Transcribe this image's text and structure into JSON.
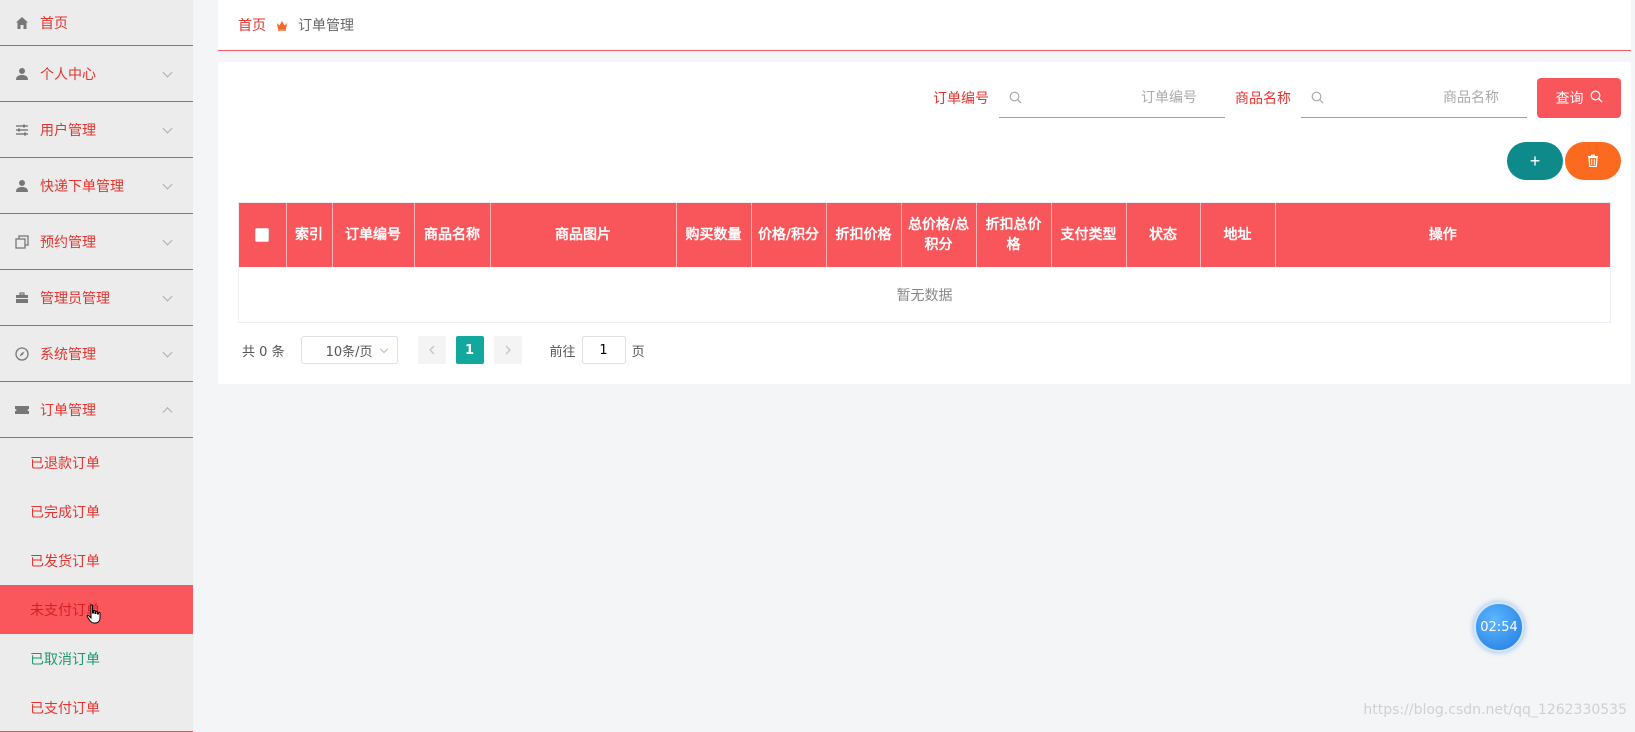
{
  "sidebar": {
    "items": [
      {
        "label": "首页",
        "icon": "home-icon"
      },
      {
        "label": "个人中心",
        "icon": "user-icon"
      },
      {
        "label": "用户管理",
        "icon": "sliders-icon"
      },
      {
        "label": "快递下单管理",
        "icon": "user-icon"
      },
      {
        "label": "预约管理",
        "icon": "copy-icon"
      },
      {
        "label": "管理员管理",
        "icon": "briefcase-icon"
      },
      {
        "label": "系统管理",
        "icon": "compass-icon"
      },
      {
        "label": "订单管理",
        "icon": "ticket-icon"
      }
    ],
    "submenu": [
      {
        "label": "已退款订单"
      },
      {
        "label": "已完成订单"
      },
      {
        "label": "已发货订单"
      },
      {
        "label": "未支付订单"
      },
      {
        "label": "已取消订单"
      },
      {
        "label": "已支付订单"
      }
    ]
  },
  "breadcrumb": {
    "home": "首页",
    "current": "订单管理"
  },
  "search": {
    "order_no_label": "订单编号",
    "order_no_placeholder": "订单编号",
    "product_label": "商品名称",
    "product_placeholder": "商品名称",
    "query_label": "查询"
  },
  "actions": {
    "add_symbol": "+"
  },
  "table": {
    "headers": [
      "索引",
      "订单编号",
      "商品名称",
      "商品图片",
      "购买数量",
      "价格/积分",
      "折扣价格",
      "总价格/总积分",
      "折扣总价格",
      "支付类型",
      "状态",
      "地址",
      "操作"
    ],
    "empty_text": "暂无数据"
  },
  "pager": {
    "total": "共 0 条",
    "page_size": "10条/页",
    "current_page": "1",
    "goto_label": "前往",
    "goto_value": "1",
    "page_unit": "页"
  },
  "timer": {
    "text": "02:54"
  },
  "watermark": "https://blog.csdn.net/qq_1262330535",
  "colors": {
    "accent": "#f9565b",
    "active_page": "#13a89e",
    "add_button": "#0f8a8a",
    "delete_button": "#fb6a1e"
  }
}
